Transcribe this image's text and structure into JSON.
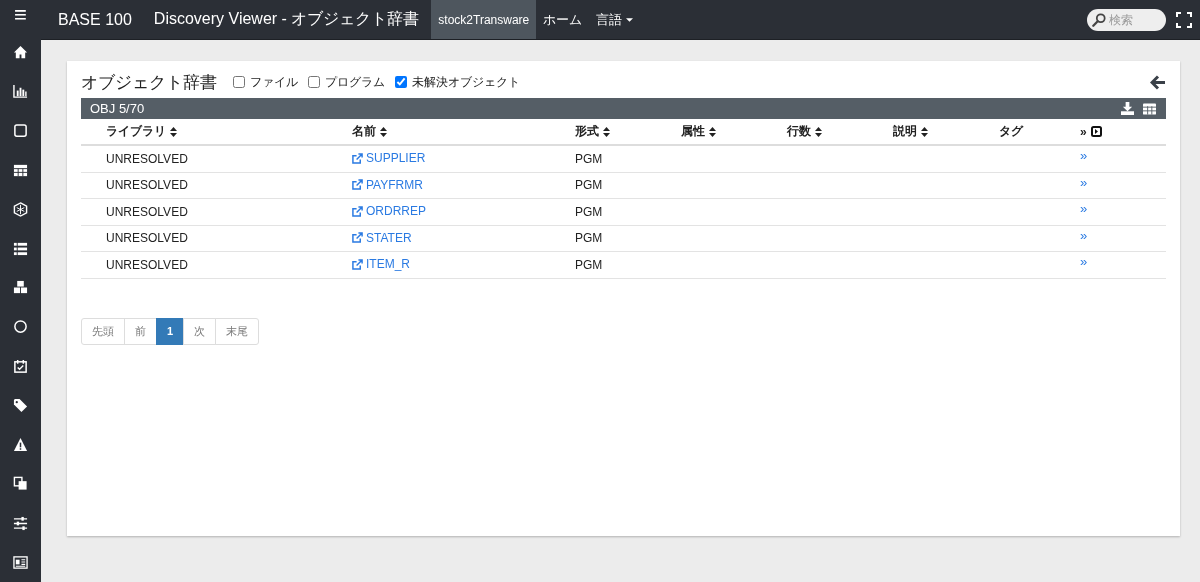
{
  "topbar": {
    "menu_glyph": "≡",
    "brand": "BASE 100",
    "title": "Discovery Viewer - オブジェクト辞書",
    "nav": [
      {
        "label": "stock2Transware",
        "selected": true
      },
      {
        "label": "ホーム",
        "selected": false
      },
      {
        "label": "言語",
        "selected": false,
        "dropdown": true
      }
    ],
    "search": {
      "placeholder": "検索"
    }
  },
  "page": {
    "title": "オブジェクト辞書",
    "filters": [
      {
        "label": "ファイル",
        "checked": false
      },
      {
        "label": "プログラム",
        "checked": false
      },
      {
        "label": "未解決オブジェクト",
        "checked": true
      }
    ]
  },
  "table": {
    "caption": "OBJ 5/70",
    "columns": [
      {
        "label": "ライブラリ",
        "sortable": true
      },
      {
        "label": "名前",
        "sortable": true
      },
      {
        "label": "形式",
        "sortable": true
      },
      {
        "label": "属性",
        "sortable": true
      },
      {
        "label": "行数",
        "sortable": true
      },
      {
        "label": "説明",
        "sortable": true
      },
      {
        "label": "タグ",
        "sortable": false
      },
      {
        "label": "»",
        "sortable": false
      }
    ],
    "rows": [
      {
        "library": "UNRESOLVED",
        "name": "SUPPLIER",
        "type": "PGM",
        "more": "»"
      },
      {
        "library": "UNRESOLVED",
        "name": "PAYFRMR",
        "type": "PGM",
        "more": "»"
      },
      {
        "library": "UNRESOLVED",
        "name": "ORDRREP",
        "type": "PGM",
        "more": "»"
      },
      {
        "library": "UNRESOLVED",
        "name": "STATER",
        "type": "PGM",
        "more": "»"
      },
      {
        "library": "UNRESOLVED",
        "name": "ITEM_R",
        "type": "PGM",
        "more": "»"
      }
    ]
  },
  "pagination": [
    {
      "label": "先頭",
      "selected": false
    },
    {
      "label": "前",
      "selected": false
    },
    {
      "label": "1",
      "selected": true
    },
    {
      "label": "次",
      "selected": false
    },
    {
      "label": "末尾",
      "selected": false
    }
  ]
}
